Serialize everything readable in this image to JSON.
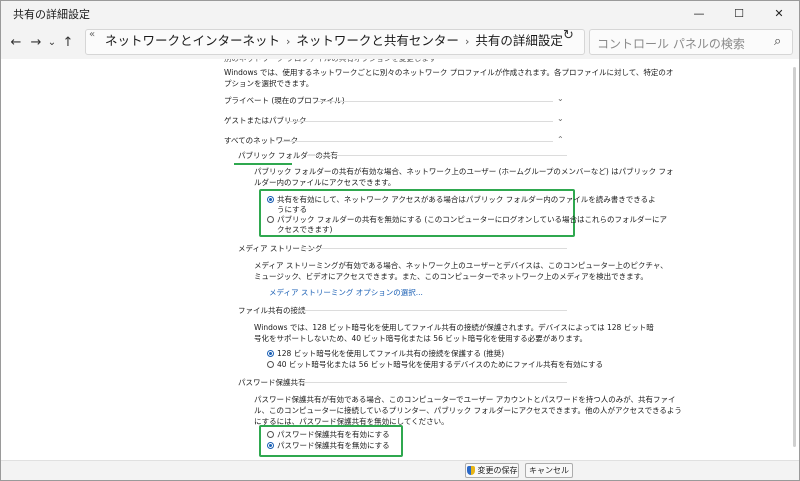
{
  "window": {
    "title": "共有の詳細設定"
  },
  "titlebar": {
    "min_glyph": "—",
    "max_glyph": "☐",
    "close_glyph": "✕"
  },
  "nav": {
    "back_glyph": "←",
    "forward_glyph": "→",
    "history_glyph": "⌄",
    "up_glyph": "↑",
    "root_glyph": "«",
    "breadcrumbs": [
      "ネットワークとインターネット",
      "ネットワークと共有センター",
      "共有の詳細設定"
    ],
    "sep_glyph": "›",
    "dropdown_glyph": "⌄",
    "refresh_glyph": "↻",
    "search_placeholder": "コントロール パネルの検索",
    "search_glyph": "⌕"
  },
  "intro": {
    "line1": "Windows では、使用するネットワークごとに別々のネットワーク プロファイルが作成されます。各プロファイルに対して、特定のオ",
    "line2": "プションを選択できます。"
  },
  "profiles": {
    "private": "プライベート (現在のプロファイル)",
    "guest": "ゲストまたはパブリック",
    "all": "すべてのネットワーク",
    "chevron_down": "⌄",
    "chevron_up": "⌃"
  },
  "public_folder": {
    "heading": "パブリック フォルダーの共有",
    "desc1": "パブリック フォルダーの共有が有効な場合、ネットワーク上のユーザー (ホームグループのメンバーなど) はパブリック フォ",
    "desc2": "ルダー内のファイルにアクセスできます。",
    "opt_on_1": "共有を有効にして、ネットワーク アクセスがある場合はパブリック フォルダー内のファイルを読み書きできるよ",
    "opt_on_2": "うにする",
    "opt_off_1": "パブリック フォルダーの共有を無効にする (このコンピューターにログオンしている場合はこれらのフォルダーにア",
    "opt_off_2": "クセスできます)"
  },
  "media": {
    "heading": "メディア ストリーミング",
    "desc1": "メディア ストリーミングが有効である場合、ネットワーク上のユーザーとデバイスは、このコンピューター上のピクチャ、",
    "desc2": "ミュージック、ビデオにアクセスできます。また、このコンピューターでネットワーク上のメディアを検出できます。",
    "link": "メディア ストリーミング オプションの選択..."
  },
  "file_sharing": {
    "heading": "ファイル共有の接続",
    "desc1": "Windows では、128 ビット暗号化を使用してファイル共有の接続が保護されます。デバイスによっては 128 ビット暗",
    "desc2": "号化をサポートしないため、40 ビット暗号化または 56 ビット暗号化を使用する必要があります。",
    "opt_128": "128 ビット暗号化を使用してファイル共有の接続を保護する (推奨)",
    "opt_40": "40 ビット暗号化または 56 ビット暗号化を使用するデバイスのためにファイル共有を有効にする"
  },
  "password": {
    "heading": "パスワード保護共有",
    "desc1": "パスワード保護共有が有効である場合、このコンピューターでユーザー アカウントとパスワードを持つ人のみが、共有ファイ",
    "desc2": "ル、このコンピューターに接続しているプリンター、パブリック フォルダーにアクセスできます。他の人がアクセスできるよう",
    "desc3": "にするには、パスワード保護共有を無効にしてください。",
    "opt_on": "パスワード保護共有を有効にする",
    "opt_off": "パスワード保護共有を無効にする"
  },
  "footer": {
    "save": "変更の保存",
    "cancel": "キャンセル"
  },
  "colors": {
    "highlight": "#2fa84f",
    "accent": "#1a5fb4"
  }
}
